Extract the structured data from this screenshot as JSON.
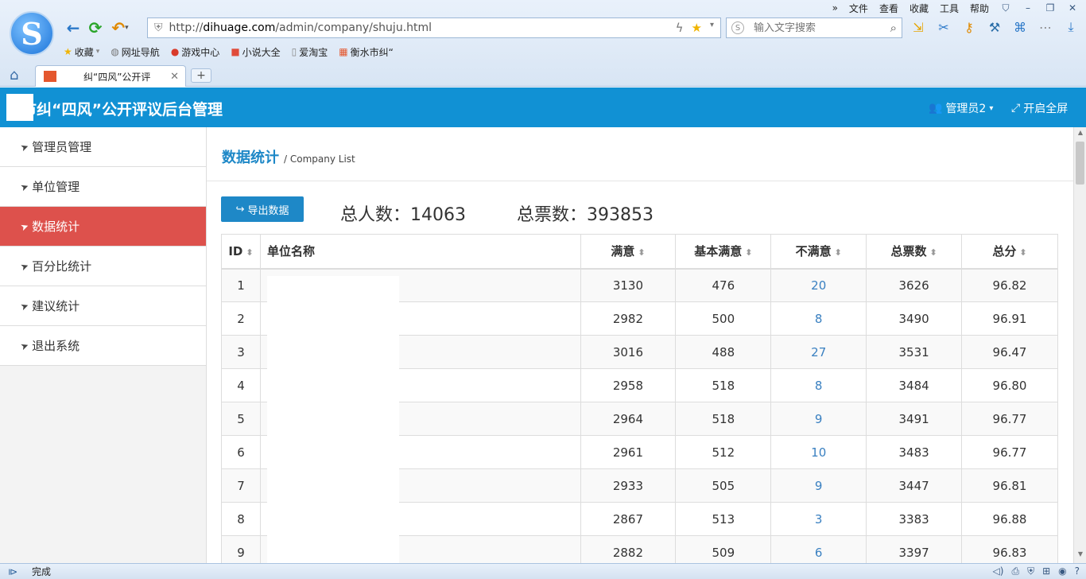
{
  "browser": {
    "menu": [
      "文件",
      "查看",
      "收藏",
      "工具",
      "帮助"
    ],
    "address": "http://dihuage.com/admin/company/shuju.html",
    "address_prefix": "http://",
    "address_domain": "dihuage.com",
    "address_path": "/admin/company/shuju.html",
    "search_placeholder": "输入文字搜索",
    "bookmarks": [
      {
        "label": "收藏",
        "icon": "star-icon"
      },
      {
        "label": "网址导航",
        "icon": "globe-icon"
      },
      {
        "label": "游戏中心",
        "icon": "game-icon"
      },
      {
        "label": "小说大全",
        "icon": "book-icon"
      },
      {
        "label": "爱淘宝",
        "icon": "page-icon"
      },
      {
        "label": "衡水市纠“",
        "icon": "site-icon"
      }
    ],
    "tab_title": "纠“四风”公开评",
    "status_text": "完成"
  },
  "header": {
    "title": "水市纠“四风”公开评议后台管理",
    "admin_label": "管理员2",
    "fullscreen_label": "开启全屏"
  },
  "sidebar": {
    "items": [
      {
        "label": "管理员管理",
        "active": false
      },
      {
        "label": "单位管理",
        "active": false
      },
      {
        "label": "数据统计",
        "active": true
      },
      {
        "label": "百分比统计",
        "active": false
      },
      {
        "label": "建议统计",
        "active": false
      },
      {
        "label": "退出系统",
        "active": false
      }
    ]
  },
  "main": {
    "page_title": "数据统计",
    "page_subtitle": "/ Company List",
    "export_label": "导出数据",
    "total_people": "总人数：14063",
    "total_votes": "总票数：393853",
    "columns": [
      "ID",
      "单位名称",
      "满意",
      "基本满意",
      "不满意",
      "总票数",
      "总分"
    ],
    "rows": [
      {
        "id": "1",
        "name": "",
        "satisfied": "3130",
        "basic": "476",
        "unsatisfied": "20",
        "total": "3626",
        "score": "96.82"
      },
      {
        "id": "2",
        "name": "",
        "satisfied": "2982",
        "basic": "500",
        "unsatisfied": "8",
        "total": "3490",
        "score": "96.91"
      },
      {
        "id": "3",
        "name": "",
        "satisfied": "3016",
        "basic": "488",
        "unsatisfied": "27",
        "total": "3531",
        "score": "96.47"
      },
      {
        "id": "4",
        "name": "",
        "satisfied": "2958",
        "basic": "518",
        "unsatisfied": "8",
        "total": "3484",
        "score": "96.80"
      },
      {
        "id": "5",
        "name": "",
        "satisfied": "2964",
        "basic": "518",
        "unsatisfied": "9",
        "total": "3491",
        "score": "96.77"
      },
      {
        "id": "6",
        "name": "",
        "satisfied": "2961",
        "basic": "512",
        "unsatisfied": "10",
        "total": "3483",
        "score": "96.77"
      },
      {
        "id": "7",
        "name": "",
        "satisfied": "2933",
        "basic": "505",
        "unsatisfied": "9",
        "total": "3447",
        "score": "96.81"
      },
      {
        "id": "8",
        "name": "",
        "satisfied": "2867",
        "basic": "513",
        "unsatisfied": "3",
        "total": "3383",
        "score": "96.88"
      },
      {
        "id": "9",
        "name": "",
        "satisfied": "2882",
        "basic": "509",
        "unsatisfied": "6",
        "total": "3397",
        "score": "96.83"
      }
    ]
  },
  "colors": {
    "header_bg": "#1191d4",
    "active_item_bg": "#dd514c",
    "accent": "#1e88c7",
    "link": "#3a80c1"
  }
}
